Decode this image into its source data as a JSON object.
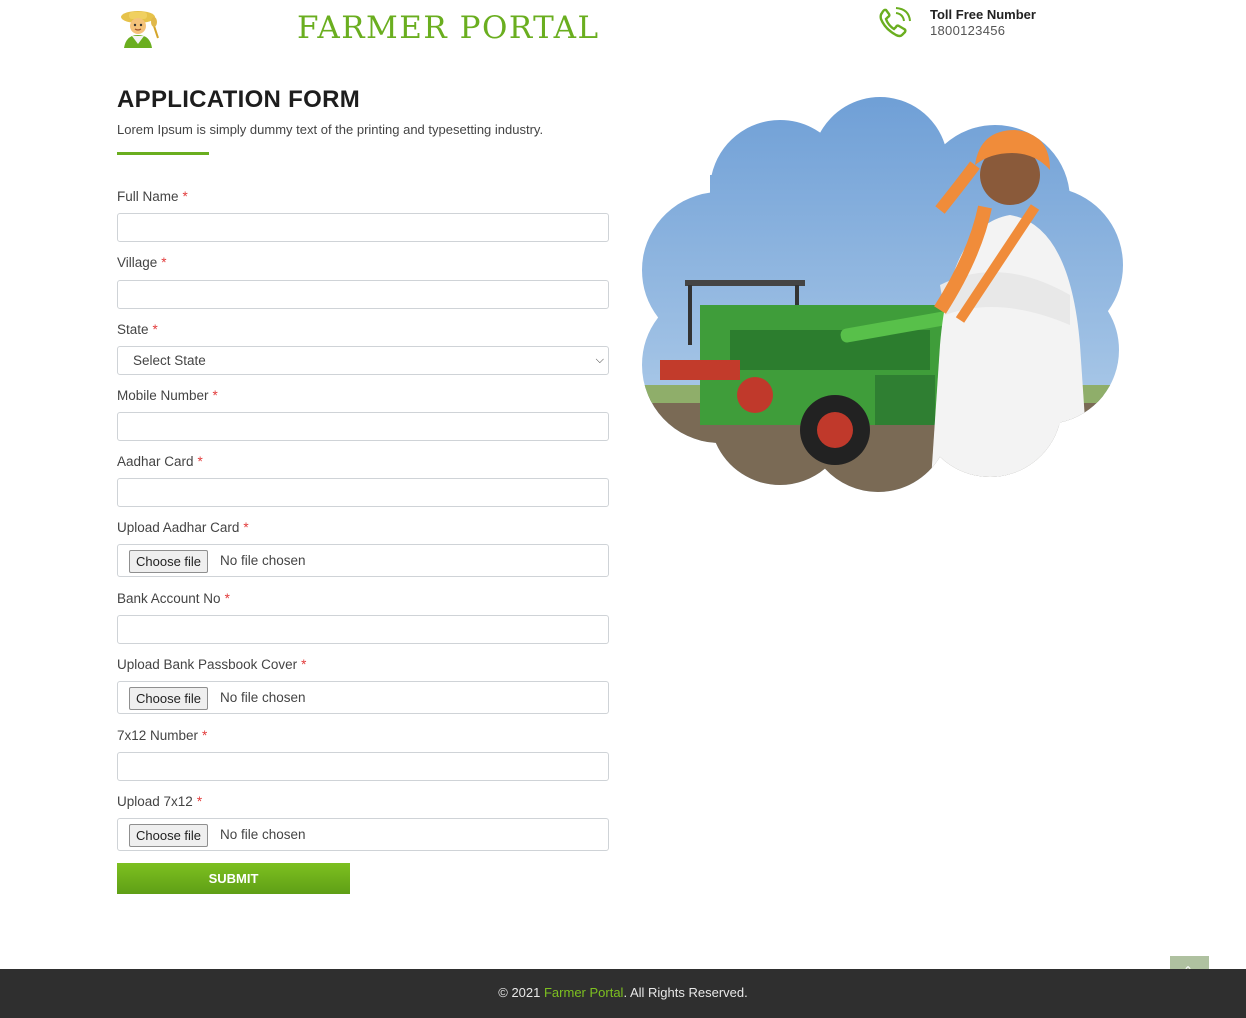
{
  "header": {
    "brand": "FARMER PORTAL",
    "tollfree_label": "Toll Free Number",
    "tollfree_number": "1800123456",
    "logo_icon": "farmer-icon",
    "phone_icon": "phone-icon"
  },
  "form": {
    "title": "APPLICATION FORM",
    "subtitle": "Lorem Ipsum is simply dummy text of the printing and typesetting industry.",
    "required_mark": "*",
    "fields": {
      "full_name": {
        "label": "Full Name",
        "value": ""
      },
      "village": {
        "label": "Village",
        "value": ""
      },
      "state": {
        "label": "State",
        "selected": "Select State"
      },
      "mobile": {
        "label": "Mobile Number",
        "value": ""
      },
      "aadhar": {
        "label": "Aadhar Card",
        "value": ""
      },
      "upload_aadhar": {
        "label": "Upload Aadhar Card",
        "button": "Choose file",
        "status": "No file chosen"
      },
      "bank_account": {
        "label": "Bank Account No",
        "value": ""
      },
      "upload_passbook": {
        "label": "Upload Bank Passbook Cover",
        "button": "Choose file",
        "status": "No file chosen"
      },
      "num_7x12": {
        "label": "7x12 Number",
        "value": ""
      },
      "upload_7x12": {
        "label": "Upload 7x12",
        "button": "Choose file",
        "status": "No file chosen"
      }
    },
    "submit_label": "SUBMIT"
  },
  "footer": {
    "prefix": "© 2021 ",
    "brand": "Farmer Portal",
    "suffix": ". All Rights Reserved."
  },
  "colors": {
    "accent": "#6aae1f",
    "required": "#e23b3b",
    "footer_bg": "#2f2f2f"
  }
}
